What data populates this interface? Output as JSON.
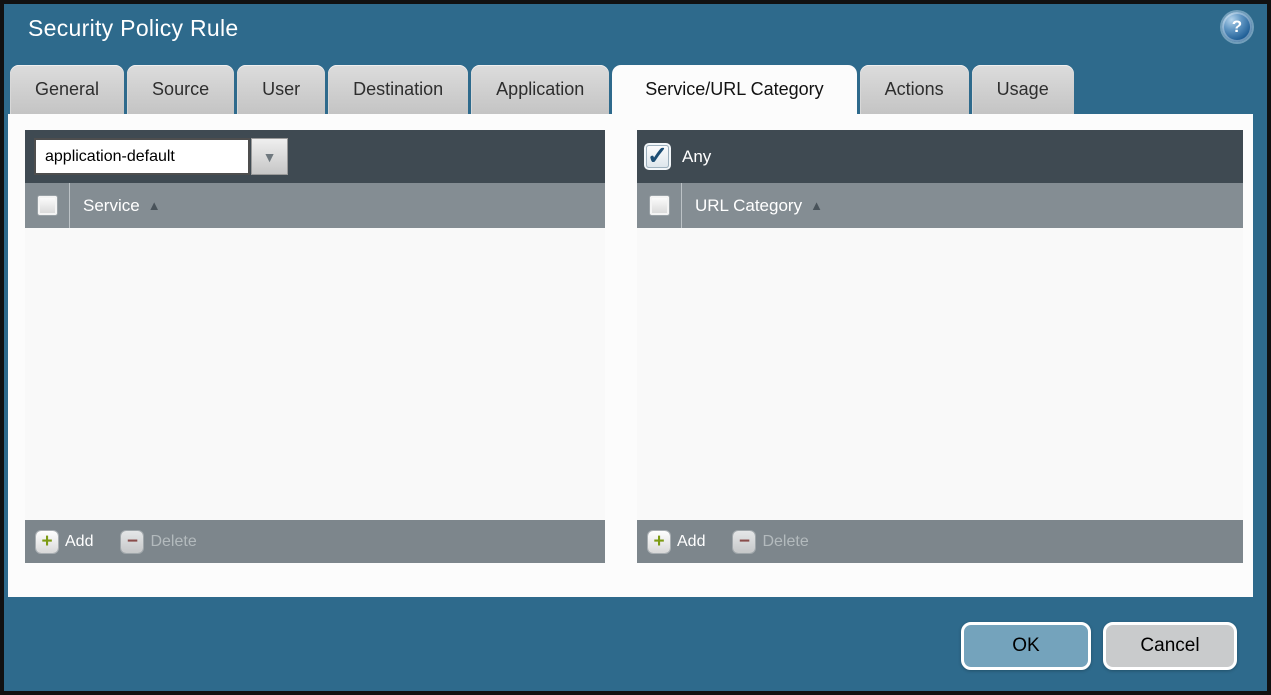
{
  "dialog": {
    "title": "Security Policy Rule"
  },
  "glyphs": {
    "help": "?",
    "dropdown_arrow": "▼",
    "sort_asc": "▲",
    "plus": "+",
    "minus": "−",
    "check": "✓"
  },
  "tabs": [
    {
      "label": "General",
      "active": false
    },
    {
      "label": "Source",
      "active": false
    },
    {
      "label": "User",
      "active": false
    },
    {
      "label": "Destination",
      "active": false
    },
    {
      "label": "Application",
      "active": false
    },
    {
      "label": "Service/URL Category",
      "active": true
    },
    {
      "label": "Actions",
      "active": false
    },
    {
      "label": "Usage",
      "active": false
    }
  ],
  "service_panel": {
    "dropdown_value": "application-default",
    "column_header": "Service",
    "add_label": "Add",
    "delete_label": "Delete",
    "rows": []
  },
  "url_category_panel": {
    "any_label": "Any",
    "any_checked": true,
    "column_header": "URL Category",
    "add_label": "Add",
    "delete_label": "Delete",
    "rows": []
  },
  "footer": {
    "ok_label": "OK",
    "cancel_label": "Cancel"
  },
  "colors": {
    "chrome_teal": "#2e6a8c",
    "toolbar_dark": "#3f4a52",
    "header_gray": "#848d93",
    "footer_gray": "#7d868c",
    "ok_blue": "#74a3bc",
    "add_green": "#7d9b14",
    "delete_red": "#8d3f3c"
  }
}
